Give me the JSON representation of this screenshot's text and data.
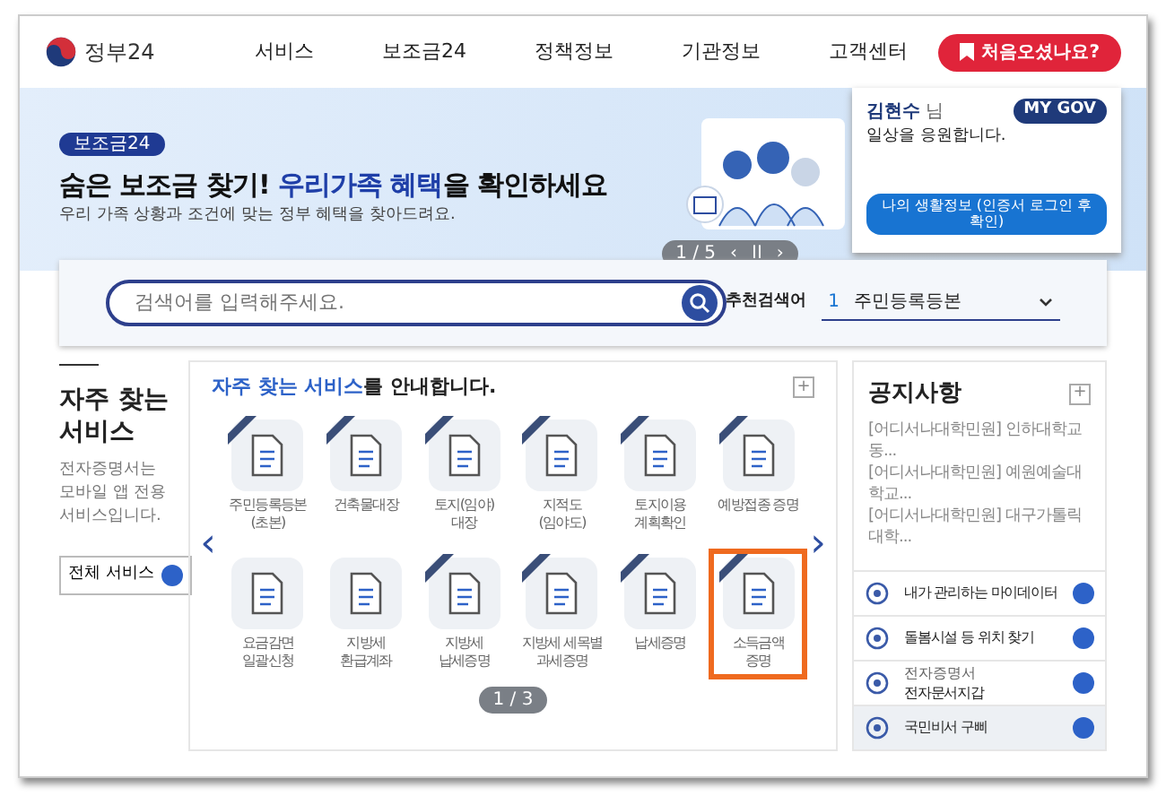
{
  "header": {
    "logo_text": "정부24",
    "nav": [
      "서비스",
      "보조금24",
      "정책정보",
      "기관정보",
      "고객센터"
    ],
    "first_visit_button": "처음오셨나요?"
  },
  "banner": {
    "badge": "보조금24",
    "headline": [
      {
        "text": "숨은 보조금 찾기! ",
        "highlight": false
      },
      {
        "text": "우리가족 혜택",
        "highlight": true
      },
      {
        "text": "을 확인하세요",
        "highlight": false
      }
    ],
    "subtitle": "우리 가족 상황과 조건에 맞는 정부 혜택을 찾아드려요.",
    "pager": {
      "count": "1 / 5",
      "prev": "‹",
      "pause": "II",
      "next": "›"
    }
  },
  "user_card": {
    "name": "김현수",
    "honorific": "님",
    "greeting": "일상을 응원합니다.",
    "my_gov": "MY GOV",
    "life_info_button": "나의 생활정보 (인증서 로그인 후 확인)"
  },
  "search": {
    "placeholder": "검색어를 입력해주세요.",
    "recommend_label": "추천검색어",
    "recommend_rank": "1",
    "recommend_term": "주민등록등본"
  },
  "frequent": {
    "title": "자주 찾는 서비스",
    "description": "전자증명서는 모바일 앱 전용 서비스입니다.",
    "all_button": "전체 서비스"
  },
  "services": {
    "heading": [
      {
        "text": "자주 찾는 서비스",
        "highlight": true
      },
      {
        "text": "를 안내합니다.",
        "highlight": false
      }
    ],
    "more": "+",
    "prev": "‹",
    "next": "›",
    "pager": "1 / 3",
    "tiles": [
      {
        "label": "주민등록등본\n(초본)",
        "ribbon": true,
        "highlighted": false
      },
      {
        "label": "건축물대장",
        "ribbon": true,
        "highlighted": false
      },
      {
        "label": "토지(임야)\n대장",
        "ribbon": true,
        "highlighted": false
      },
      {
        "label": "지적도\n(임야도)",
        "ribbon": true,
        "highlighted": false
      },
      {
        "label": "토지이용\n계획확인",
        "ribbon": true,
        "highlighted": false
      },
      {
        "label": "예방접종 증명",
        "ribbon": true,
        "highlighted": false
      },
      {
        "label": "요금감면\n일괄신청",
        "ribbon": false,
        "highlighted": false
      },
      {
        "label": "지방세\n환급계좌",
        "ribbon": false,
        "highlighted": false
      },
      {
        "label": "지방세\n납세증명",
        "ribbon": true,
        "highlighted": false
      },
      {
        "label": "지방세 세목별\n과세증명",
        "ribbon": true,
        "highlighted": false
      },
      {
        "label": "납세증명",
        "ribbon": true,
        "highlighted": false
      },
      {
        "label": "소득금액\n증명",
        "ribbon": true,
        "highlighted": true
      }
    ]
  },
  "notices": {
    "title": "공지사항",
    "more": "+",
    "items": [
      "[어디서나대학민원] 인하대학교 동...",
      "[어디서나대학민원] 예원예술대학교...",
      "[어디서나대학민원] 대구가톨릭대학..."
    ]
  },
  "quick_links": [
    {
      "label": "내가 관리하는 마이데이터",
      "selected": false
    },
    {
      "label": "돌봄시설 등 위치 찾기",
      "selected": false
    },
    {
      "label": "전자문서지갑",
      "caption": "전자증명서",
      "selected": false
    },
    {
      "label": "국민비서 구삐",
      "selected": true
    }
  ]
}
